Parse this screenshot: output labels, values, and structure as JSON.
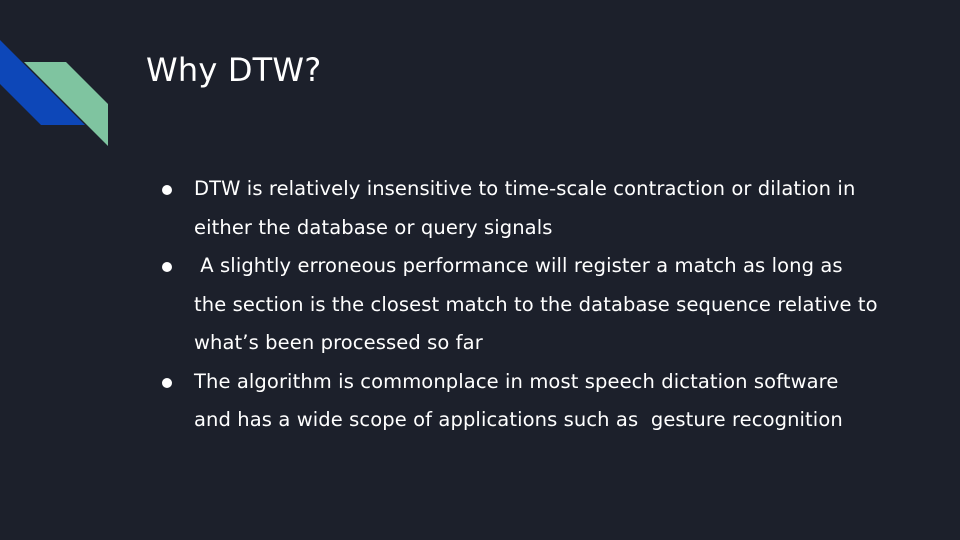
{
  "slide": {
    "title": "Why DTW?",
    "bullets": [
      {
        "text": "DTW is relatively insensitive to time-scale contraction or dilation in either the database or query signals"
      },
      {
        "text": " A slightly erroneous performance will register a match as long as the section is the closest match to the database sequence relative to what’s been processed so far"
      },
      {
        "text": "The algorithm is commonplace in most speech dictation software and has a wide scope of applications such as  gesture recognition"
      }
    ]
  },
  "colors": {
    "background": "#1c202b",
    "text": "#ffffff",
    "accent_blue": "#0d47b8",
    "accent_green": "#7fc4a0"
  }
}
